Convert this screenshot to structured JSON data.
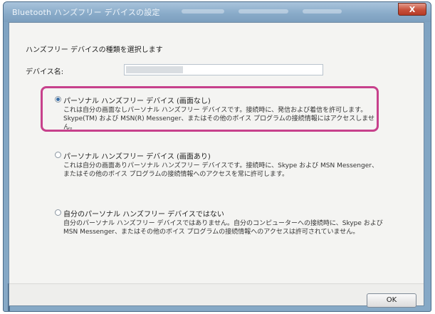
{
  "window": {
    "title": "Bluetooth ハンズフリー デバイスの設定",
    "close_label": "X"
  },
  "instruction": "ハンズフリー デバイスの種類を選択します",
  "device_name": {
    "label": "デバイス名:",
    "value": ""
  },
  "options": [
    {
      "label": "パーソナル ハンズフリー デバイス (画面なし)",
      "description": "これは自分の画面なしパーソナル ハンズフリー デバイスです。接続時に、発信および着信を許可します。Skype(TM) および MSN(R) Messenger、またはその他のボイス プログラムの接続情報にはアクセスしません。",
      "selected": true
    },
    {
      "label": "パーソナル ハンズフリー デバイス (画面あり)",
      "description": "これは自分の画面ありパーソナル ハンズフリー デバイスです。接続時に、Skype および MSN Messenger、またはその他のボイス プログラムの接続情報へのアクセスを常に許可します。",
      "selected": false
    },
    {
      "label": "自分のパーソナル ハンズフリー デバイスではない",
      "description": "自分のパーソナル ハンズフリー デバイスではありません。自分のコンピューターへの接続時に、Skype および MSN Messenger、またはその他のボイス プログラムの接続情報へのアクセスは許可されていません。",
      "selected": false
    }
  ],
  "buttons": {
    "ok_label": "OK"
  },
  "colors": {
    "highlight": "#c7418c",
    "radio_selected": "#3a6ea5",
    "titlebar": "#88aac8"
  }
}
